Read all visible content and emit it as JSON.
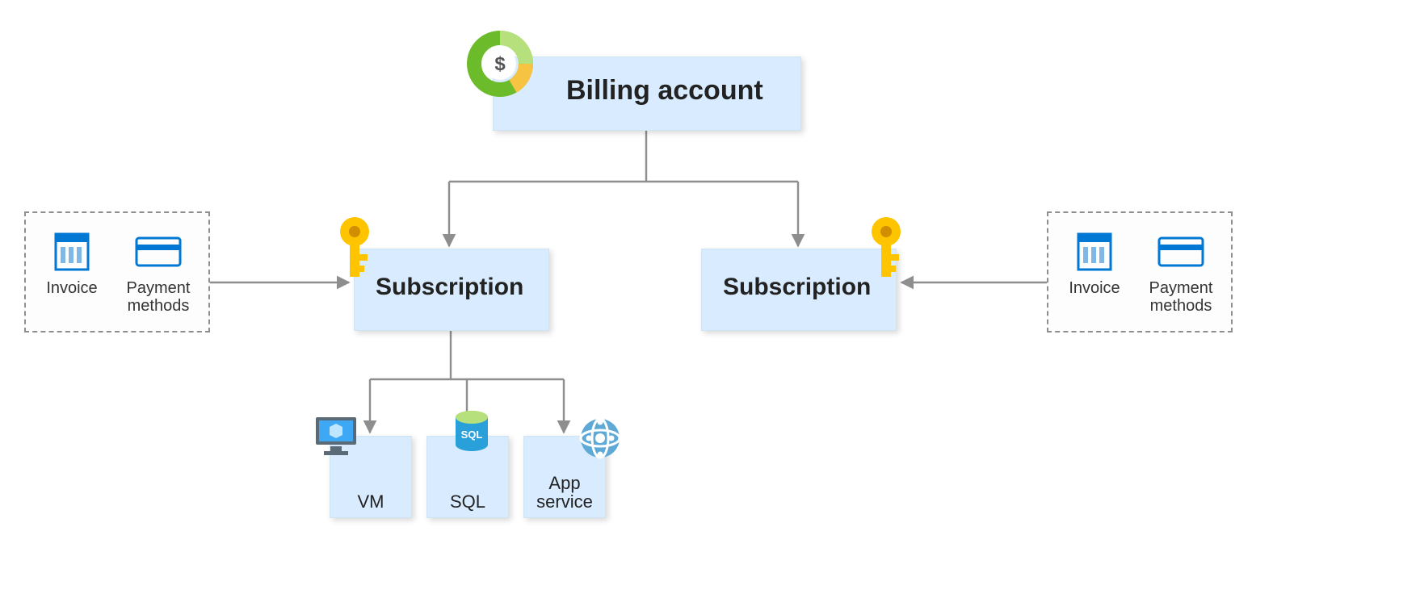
{
  "nodes": {
    "billing": {
      "label": "Billing account"
    },
    "subscription1": {
      "label": "Subscription"
    },
    "subscription2": {
      "label": "Subscription"
    },
    "vm": {
      "label": "VM"
    },
    "sql": {
      "label": "SQL"
    },
    "app": {
      "label": "App\nservice"
    }
  },
  "panels": {
    "left": {
      "invoice_label": "Invoice",
      "payment_label": "Payment\nmethods"
    },
    "right": {
      "invoice_label": "Invoice",
      "payment_label": "Payment\nmethods"
    }
  },
  "icons": {
    "billing": "cost-donut-icon",
    "subscription": "key-icon",
    "vm": "vm-icon",
    "sql": "sql-database-icon",
    "app": "app-service-icon",
    "invoice": "invoice-icon",
    "payment": "credit-card-icon"
  },
  "colors": {
    "node_bg": "#d9ecff",
    "connector": "#8e8e8e",
    "accent_blue": "#0078d4",
    "key_yellow": "#ffc400",
    "donut_green": "#6cbb2a",
    "donut_yellow": "#f6c342"
  }
}
